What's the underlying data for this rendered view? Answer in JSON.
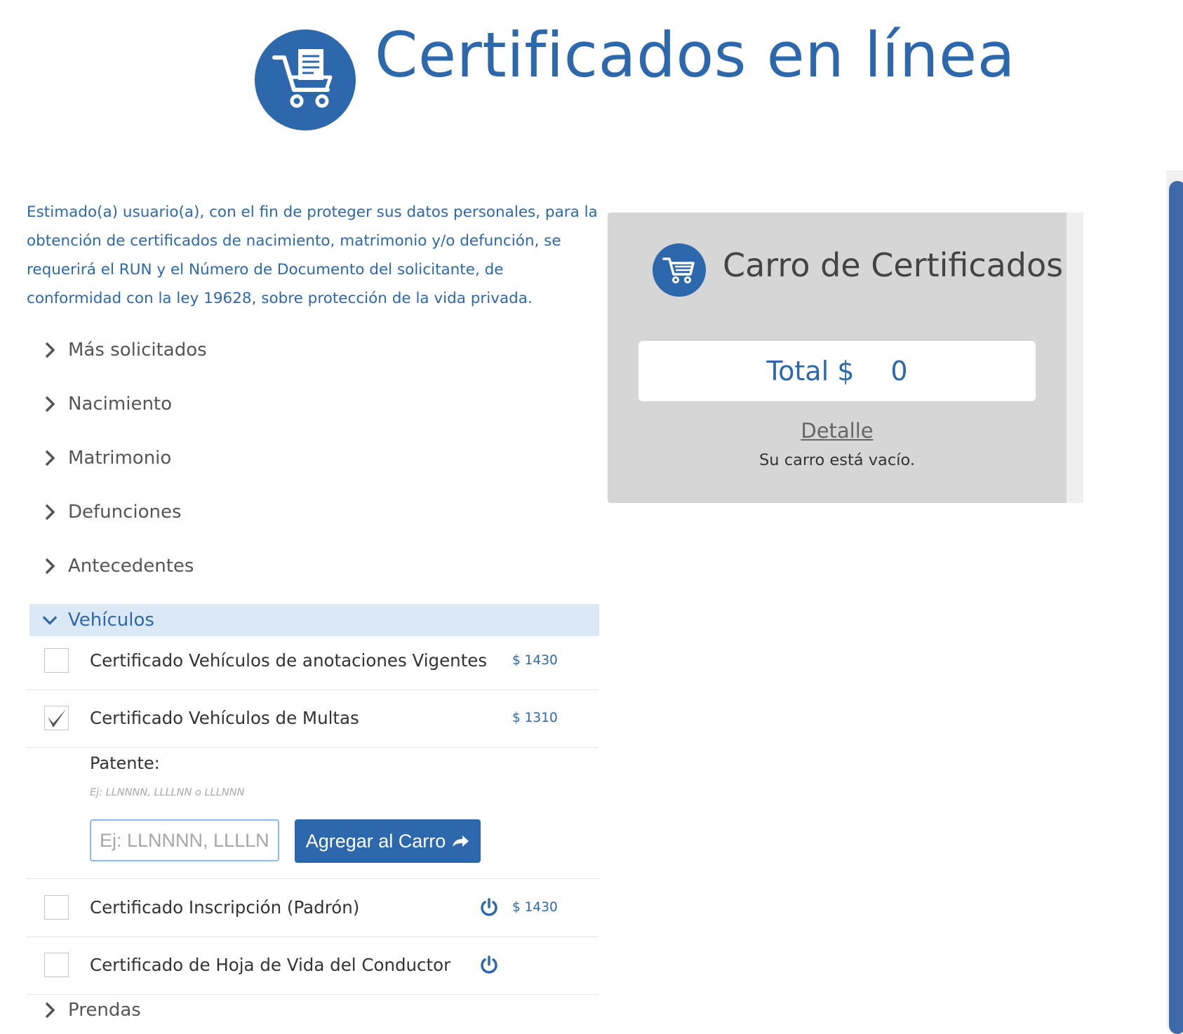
{
  "header": {
    "title": "Certificados en línea"
  },
  "intro": {
    "text": "Estimado(a) usuario(a), con el fin de proteger sus datos personales, para la obtención de certificados de nacimiento, matrimonio y/o defunción, se requerirá el RUN y el Número de Documento del solicitante, de conformidad con la ley 19628, sobre protección de la vida privada."
  },
  "accordion": {
    "items": [
      {
        "label": "Más solicitados",
        "expanded": false
      },
      {
        "label": "Nacimiento",
        "expanded": false
      },
      {
        "label": "Matrimonio",
        "expanded": false
      },
      {
        "label": "Defunciones",
        "expanded": false
      },
      {
        "label": "Antecedentes",
        "expanded": false
      },
      {
        "label": "Vehículos",
        "expanded": true
      },
      {
        "label": "Prendas",
        "expanded": false
      }
    ]
  },
  "vehiculos": {
    "certificates": [
      {
        "label": "Certificado Vehículos de anotaciones Vigentes",
        "price": "$ 1430",
        "checked": false,
        "power_icon": false
      },
      {
        "label": "Certificado Vehículos de Multas",
        "price": "$ 1310",
        "checked": true,
        "power_icon": false
      },
      {
        "label": "Certificado Inscripción (Padrón)",
        "price": "$ 1430",
        "checked": false,
        "power_icon": true
      },
      {
        "label": "Certificado de Hoja de Vida del Conductor",
        "price": "",
        "checked": false,
        "power_icon": true
      }
    ],
    "patente": {
      "label": "Patente:",
      "hint": "Ej: LLNNNN, LLLLNN o LLLNNN",
      "placeholder": "Ej: LLNNNN, LLLLNN o LLLNNN",
      "value": "",
      "add_button_label": "Agregar al Carro"
    }
  },
  "cart": {
    "title": "Carro de Certificados",
    "total_label": "Total $",
    "total_value": "0",
    "detail_link": "Detalle",
    "empty_message": "Su carro está vacío."
  },
  "colors": {
    "brand_blue": "#2d68ad",
    "panel_gray": "#d6d6d6",
    "accordion_open_bg": "#dbe8f5",
    "scrollbar_thumb": "#3e69a8"
  }
}
